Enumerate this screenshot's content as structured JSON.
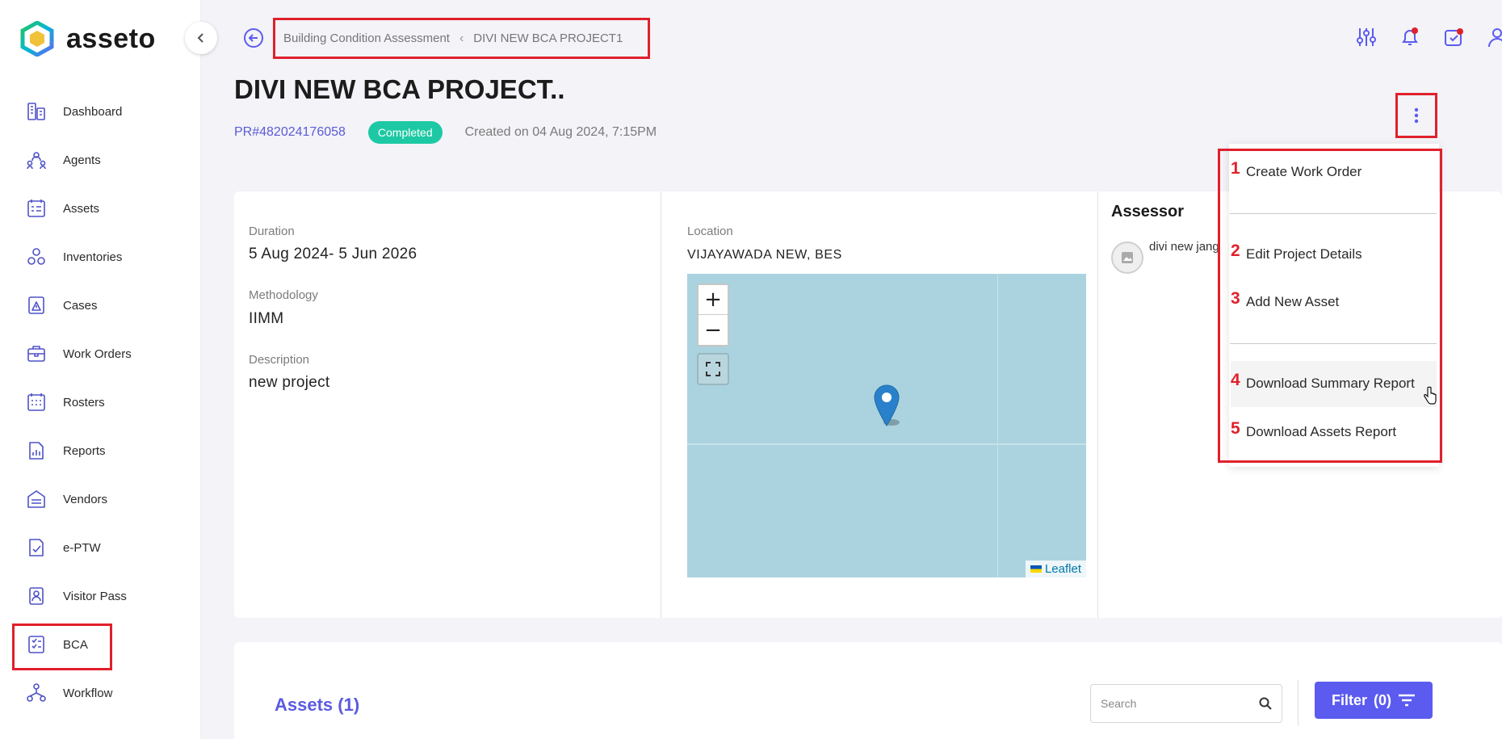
{
  "app": {
    "name": "asseto",
    "accent": "#5b5bf0",
    "highlight": "#e0202b"
  },
  "sidebar": {
    "items": [
      {
        "label": "Dashboard",
        "icon": "dashboard-icon"
      },
      {
        "label": "Agents",
        "icon": "agents-icon"
      },
      {
        "label": "Assets",
        "icon": "assets-icon"
      },
      {
        "label": "Inventories",
        "icon": "inventories-icon"
      },
      {
        "label": "Cases",
        "icon": "cases-icon"
      },
      {
        "label": "Work Orders",
        "icon": "work-orders-icon"
      },
      {
        "label": "Rosters",
        "icon": "rosters-icon"
      },
      {
        "label": "Reports",
        "icon": "reports-icon"
      },
      {
        "label": "Vendors",
        "icon": "vendors-icon"
      },
      {
        "label": "e-PTW",
        "icon": "eptw-icon"
      },
      {
        "label": "Visitor Pass",
        "icon": "visitor-pass-icon"
      },
      {
        "label": "BCA",
        "icon": "bca-icon",
        "active": true
      },
      {
        "label": "Workflow",
        "icon": "workflow-icon"
      }
    ]
  },
  "breadcrumb": {
    "parent": "Building Condition Assessment",
    "current": "DIVI NEW BCA PROJECT1"
  },
  "project": {
    "title": "DIVI NEW BCA PROJECT..",
    "id": "PR#482024176058",
    "status": "Completed",
    "created": "Created on 04 Aug 2024, 7:15PM"
  },
  "details": {
    "duration_label": "Duration",
    "duration": "5 Aug 2024- 5 Jun 2026",
    "methodology_label": "Methodology",
    "methodology": "IIMM",
    "description_label": "Description",
    "description": "new project",
    "location_label": "Location",
    "location": "VIJAYAWADA NEW, BES",
    "map_attribution": "Leaflet",
    "zoom_in": "+",
    "zoom_out": "−",
    "assessor_title": "Assessor",
    "assessor_name": "divi new jang"
  },
  "menu": {
    "items": [
      {
        "num": "1",
        "label": "Create Work Order"
      },
      {
        "num": "2",
        "label": "Edit Project Details"
      },
      {
        "num": "3",
        "label": "Add New Asset"
      },
      {
        "num": "4",
        "label": "Download Summary Report"
      },
      {
        "num": "5",
        "label": "Download Assets Report"
      }
    ]
  },
  "assets": {
    "title": "Assets (1)",
    "search_placeholder": "Search",
    "filter_label": "Filter",
    "filter_count": "(0)"
  }
}
